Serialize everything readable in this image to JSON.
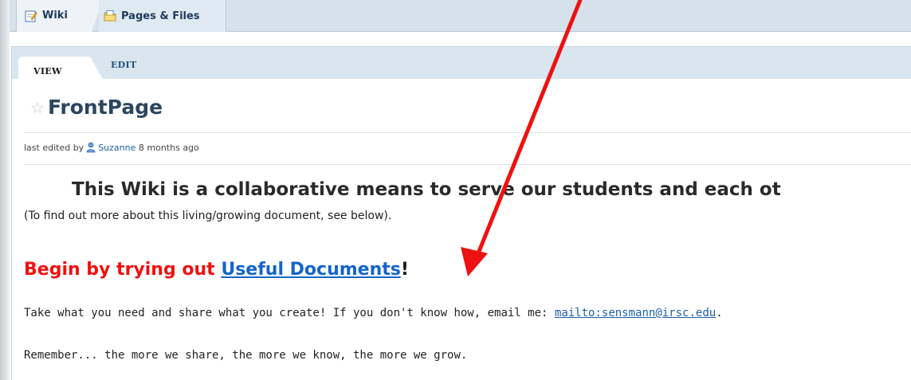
{
  "top_tabs": {
    "wiki": {
      "label": "Wiki",
      "icon": "pencil-page-icon"
    },
    "pages": {
      "label": "Pages & Files",
      "icon": "folder-page-icon"
    }
  },
  "page_tabs": {
    "view": "VIEW",
    "edit": "EDIT"
  },
  "page": {
    "title": "FrontPage",
    "meta": {
      "prefix": "last edited by",
      "user": "Suzanne",
      "suffix": "8 months ago"
    },
    "headline": "This Wiki is a collaborative means to serve our students and each ot",
    "subnote": "(To find out more about this living/growing document, see below).",
    "begin": {
      "text": "Begin by trying out",
      "link": "Useful Documents",
      "end": "!"
    },
    "take_line": {
      "text": "Take what you need and share what you create!  If you don't know how, email me:",
      "link": "mailto:sensmann@irsc.edu",
      "end": "."
    },
    "remember_line": "Remember... the more we share, the more we know, the more we grow."
  },
  "colors": {
    "accent_red": "#ee1111",
    "link_blue": "#1565c9",
    "title_blue": "#2b4660",
    "tab_bar": "#d5e2ec",
    "annotation_arrow": "#ee1111"
  }
}
